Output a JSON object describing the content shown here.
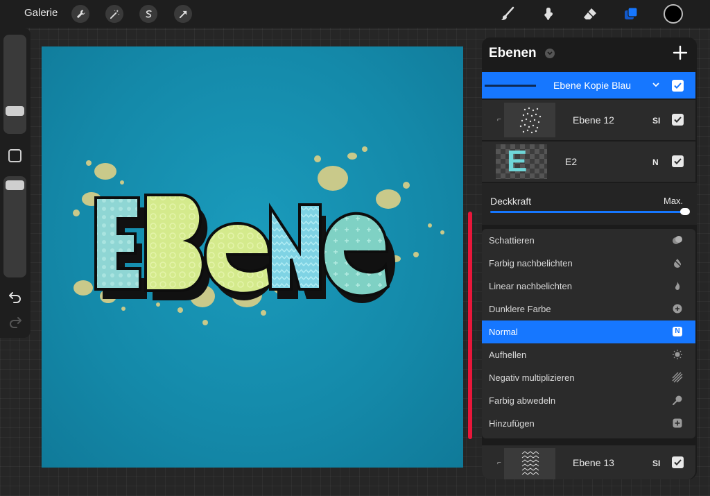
{
  "topbar": {
    "gallery_label": "Galerie",
    "left_tools": [
      {
        "icon": "wrench-icon"
      },
      {
        "icon": "magic-wand-icon"
      },
      {
        "icon": "selection-icon"
      },
      {
        "icon": "transform-arrow-icon"
      }
    ],
    "right_tools": [
      {
        "icon": "brush-icon"
      },
      {
        "icon": "smudge-icon"
      },
      {
        "icon": "eraser-icon"
      },
      {
        "icon": "layers-icon"
      }
    ],
    "current_color": "#000000",
    "accent": "#1677ff"
  },
  "canvas": {
    "text": "EBENE",
    "background_color": "#1489a9",
    "splash_color": "#c9c98a"
  },
  "layers_panel": {
    "title": "Ebenen",
    "layers": [
      {
        "name": "Ebene Kopie Blau",
        "active": true,
        "visible": true
      },
      {
        "name": "Ebene 12",
        "mode": "SI",
        "visible": true,
        "clipped": true
      },
      {
        "name": "E2",
        "mode": "N",
        "visible": true,
        "thumb_letter": "E"
      },
      {
        "name": "Ebene 13",
        "mode": "SI",
        "visible": true,
        "clipped": true
      }
    ],
    "opacity": {
      "label": "Deckkraft",
      "value_label": "Max.",
      "value": 1.0
    },
    "blend_modes": [
      {
        "label": "Schattieren",
        "icon": "half-circles-icon"
      },
      {
        "label": "Farbig nachbelichten",
        "icon": "burn-icon"
      },
      {
        "label": "Linear nachbelichten",
        "icon": "flame-icon"
      },
      {
        "label": "Dunklere Farbe",
        "icon": "plus-circle-icon"
      },
      {
        "label": "Normal",
        "icon": "n-badge-icon",
        "selected": true,
        "badge": "N"
      },
      {
        "label": "Aufhellen",
        "icon": "sun-icon"
      },
      {
        "label": "Negativ multiplizieren",
        "icon": "stripes-icon"
      },
      {
        "label": "Farbig abwedeln",
        "icon": "dodge-icon"
      },
      {
        "label": "Hinzufügen",
        "icon": "plus-square-icon"
      }
    ]
  }
}
